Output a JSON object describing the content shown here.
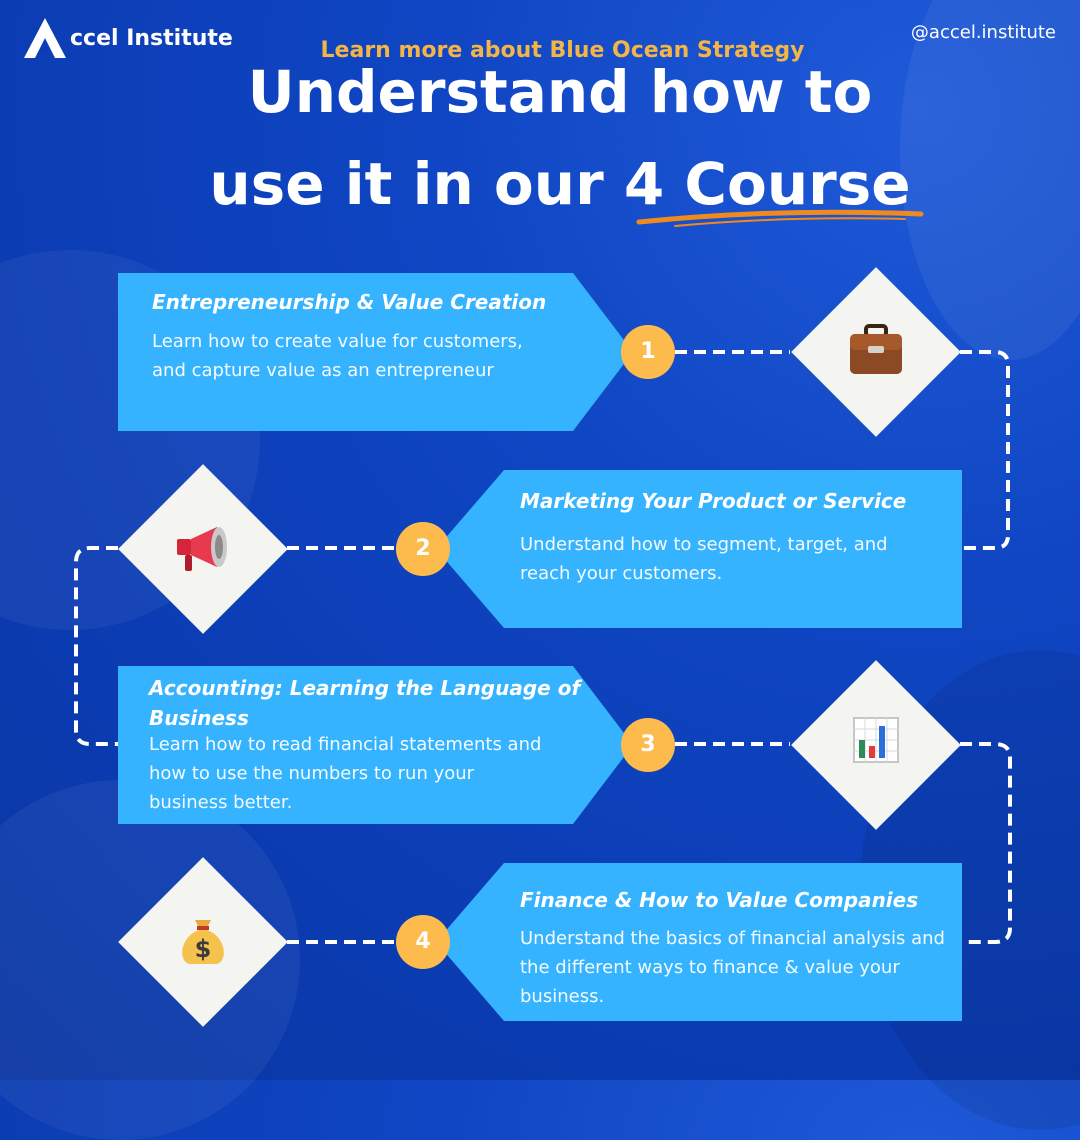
{
  "brand": {
    "name": "ccel Institute",
    "handle": "@accel.institute"
  },
  "header": {
    "subtitle": "Learn more about Blue Ocean Strategy",
    "title_line1": "Understand how to",
    "title_line2": "use it in our 4 Course"
  },
  "courses": [
    {
      "number": "1",
      "title": "Entrepreneurship & Value Creation",
      "description": "Learn how to create value for customers, and capture value as an entrepreneur",
      "icon": "briefcase-icon"
    },
    {
      "number": "2",
      "title": "Marketing Your Product or Service",
      "description": "Understand how to segment, target, and reach your customers.",
      "icon": "megaphone-icon"
    },
    {
      "number": "3",
      "title": "Accounting: Learning the Language of Business",
      "description": "Learn how to read financial statements and how to use the numbers to run your business better.",
      "icon": "bar-chart-icon"
    },
    {
      "number": "4",
      "title": "Finance & How to Value Companies",
      "description": "Understand the basics of financial analysis and the different ways to finance & value your business.",
      "icon": "money-bag-icon"
    }
  ],
  "colors": {
    "background": "#0b3cb3",
    "card": "#35b3ff",
    "accent": "#fdbb4d",
    "subtitle": "#f5b546"
  }
}
